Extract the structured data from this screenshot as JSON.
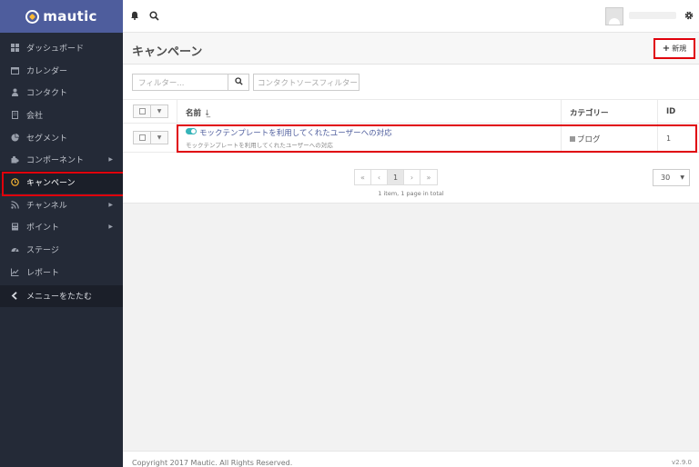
{
  "app": {
    "logo_text": "mautic"
  },
  "sidebar": {
    "items": [
      {
        "label": "ダッシュボード",
        "icon": "dashboard-icon"
      },
      {
        "label": "カレンダー",
        "icon": "calendar-icon"
      },
      {
        "label": "コンタクト",
        "icon": "user-icon"
      },
      {
        "label": "会社",
        "icon": "building-icon"
      },
      {
        "label": "セグメント",
        "icon": "pie-chart-icon"
      },
      {
        "label": "コンポーネント",
        "icon": "puzzle-icon"
      },
      {
        "label": "キャンペーン",
        "icon": "clock-icon"
      },
      {
        "label": "チャンネル",
        "icon": "rss-icon"
      },
      {
        "label": "ポイント",
        "icon": "calculator-icon"
      },
      {
        "label": "ステージ",
        "icon": "gauge-icon"
      },
      {
        "label": "レポート",
        "icon": "line-chart-icon"
      }
    ],
    "collapse_label": "メニューをたたむ"
  },
  "header": {
    "title": "キャンペーン",
    "new_button": "新規"
  },
  "filters": {
    "filter_placeholder": "フィルター...",
    "source_placeholder": "コンタクトソースフィルター"
  },
  "table": {
    "columns": {
      "name": "名前",
      "category": "カテゴリー",
      "id": "ID"
    },
    "rows": [
      {
        "name": "モックテンプレートを利用してくれたユーザーへの対応",
        "description": "モックテンプレートを利用してくれたユーザーへの対応",
        "category": "ブログ",
        "id": "1",
        "published": true
      }
    ]
  },
  "pagination": {
    "first": "«",
    "prev": "‹",
    "current": "1",
    "next": "›",
    "last": "»",
    "info": "1 item, 1 page in total",
    "limit": "30"
  },
  "footer": {
    "copyright": "Copyright 2017 Mautic. All Rights Reserved.",
    "version": "v2.9.0"
  },
  "colors": {
    "sidebar_bg": "#242a37",
    "logo_bg": "#4e5d9d",
    "accent": "#fdb933",
    "highlight": "#e0000b",
    "toggle_on": "#35b4b9"
  }
}
